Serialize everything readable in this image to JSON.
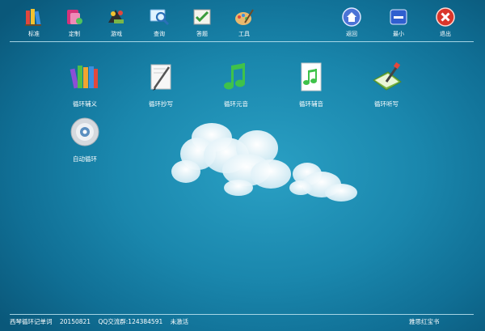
{
  "toolbar": {
    "left": [
      {
        "label": "标准",
        "icon": "books-icon"
      },
      {
        "label": "定制",
        "icon": "customize-icon"
      },
      {
        "label": "游戏",
        "icon": "game-icon"
      },
      {
        "label": "查询",
        "icon": "search-icon"
      },
      {
        "label": "答题",
        "icon": "answer-icon"
      },
      {
        "label": "工具",
        "icon": "palette-icon"
      }
    ],
    "right": [
      {
        "label": "返回",
        "icon": "home-icon"
      },
      {
        "label": "最小",
        "icon": "minimize-icon"
      },
      {
        "label": "退出",
        "icon": "close-icon"
      }
    ]
  },
  "apps": [
    {
      "label": "循环辅义",
      "icon": "books-icon"
    },
    {
      "label": "循环抄写",
      "icon": "pen-icon"
    },
    {
      "label": "循环元音",
      "icon": "music-note-icon"
    },
    {
      "label": "循环辅音",
      "icon": "music-doc-icon"
    },
    {
      "label": "循环听写",
      "icon": "writing-pad-icon"
    },
    {
      "label": "自动循环",
      "icon": "cd-icon"
    }
  ],
  "status": {
    "app_name": "西琴循环记单词",
    "version": "20150821",
    "qq_group": "QQ交流群:124384591",
    "activation": "未激活",
    "brand": "雅思红宝书"
  },
  "colors": {
    "background": "#1a87ad",
    "divider": "#bfe6f2"
  }
}
